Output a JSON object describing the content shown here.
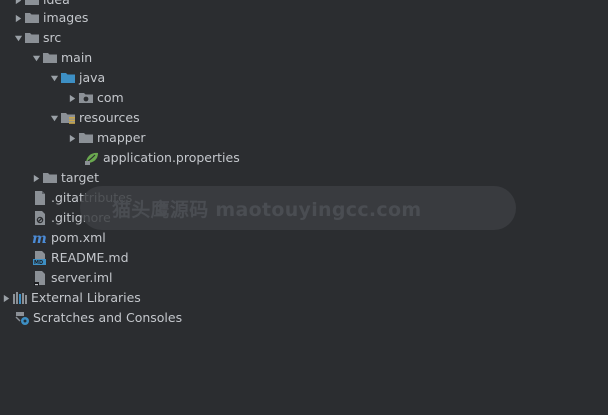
{
  "tree": {
    "items": [
      {
        "label": "idea",
        "icon": "folder-icon",
        "expanded": false
      },
      {
        "label": "images",
        "icon": "folder-icon",
        "expanded": false
      },
      {
        "label": "src",
        "icon": "folder-icon",
        "expanded": true
      },
      {
        "label": "main",
        "icon": "folder-icon",
        "expanded": true
      },
      {
        "label": "java",
        "icon": "source-folder-icon",
        "expanded": true
      },
      {
        "label": "com",
        "icon": "package-icon",
        "expanded": false
      },
      {
        "label": "resources",
        "icon": "resources-folder-icon",
        "expanded": true
      },
      {
        "label": "mapper",
        "icon": "folder-icon",
        "expanded": false
      },
      {
        "label": "application.properties",
        "icon": "spring-properties-icon"
      },
      {
        "label": "target",
        "icon": "folder-icon",
        "expanded": false
      },
      {
        "label": ".gitattributes",
        "icon": "file-icon"
      },
      {
        "label": ".gitignore",
        "icon": "gitignore-icon"
      },
      {
        "label": "pom.xml",
        "icon": "maven-icon"
      },
      {
        "label": "README.md",
        "icon": "markdown-icon"
      },
      {
        "label": "server.iml",
        "icon": "iml-file-icon"
      },
      {
        "label": "External Libraries",
        "icon": "libraries-icon",
        "expanded": false
      },
      {
        "label": "Scratches and Consoles",
        "icon": "scratches-icon"
      }
    ]
  },
  "watermark": {
    "text": "猫头鹰源码 maotouyingcc.com"
  },
  "colors": {
    "background": "#2b2d30",
    "text": "#c4c7cc",
    "folder": "#8b9096",
    "source_folder": "#3d8fc4",
    "spring": "#6aa84f",
    "maven": "#4b8bd6"
  }
}
